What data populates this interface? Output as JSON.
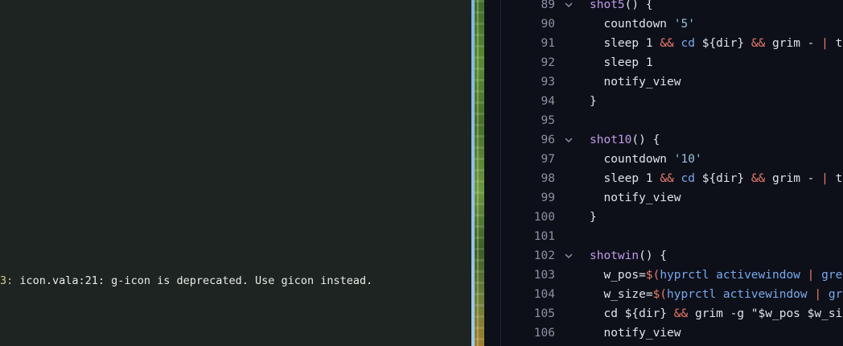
{
  "terminal": {
    "line_prefix": "3:",
    "line_message": " icon.vala:21: g-icon is deprecated. Use gicon instead."
  },
  "editor": {
    "lines": [
      {
        "num": "89",
        "fold": true,
        "tokens": [
          {
            "t": "shot5",
            "c": "fn"
          },
          {
            "t": "() {",
            "c": "pl"
          }
        ]
      },
      {
        "num": "90",
        "fold": false,
        "tokens": [
          {
            "t": "  countdown ",
            "c": "pl"
          },
          {
            "t": "'5'",
            "c": "str"
          }
        ]
      },
      {
        "num": "91",
        "fold": false,
        "tokens": [
          {
            "t": "  sleep 1 ",
            "c": "pl"
          },
          {
            "t": "&&",
            "c": "op"
          },
          {
            "t": " ",
            "c": "pl"
          },
          {
            "t": "cd",
            "c": "kw"
          },
          {
            "t": " ${dir} ",
            "c": "pl"
          },
          {
            "t": "&&",
            "c": "op"
          },
          {
            "t": " grim - ",
            "c": "pl"
          },
          {
            "t": "|",
            "c": "op"
          },
          {
            "t": " te",
            "c": "pl"
          }
        ]
      },
      {
        "num": "92",
        "fold": false,
        "tokens": [
          {
            "t": "  sleep 1",
            "c": "pl"
          }
        ]
      },
      {
        "num": "93",
        "fold": false,
        "tokens": [
          {
            "t": "  notify_view",
            "c": "pl"
          }
        ]
      },
      {
        "num": "94",
        "fold": false,
        "tokens": [
          {
            "t": "}",
            "c": "pl"
          }
        ]
      },
      {
        "num": "95",
        "fold": false,
        "tokens": []
      },
      {
        "num": "96",
        "fold": true,
        "tokens": [
          {
            "t": "shot10",
            "c": "fn"
          },
          {
            "t": "() {",
            "c": "pl"
          }
        ]
      },
      {
        "num": "97",
        "fold": false,
        "tokens": [
          {
            "t": "  countdown ",
            "c": "pl"
          },
          {
            "t": "'10'",
            "c": "str"
          }
        ]
      },
      {
        "num": "98",
        "fold": false,
        "tokens": [
          {
            "t": "  sleep 1 ",
            "c": "pl"
          },
          {
            "t": "&&",
            "c": "op"
          },
          {
            "t": " ",
            "c": "pl"
          },
          {
            "t": "cd",
            "c": "kw"
          },
          {
            "t": " ${dir} ",
            "c": "pl"
          },
          {
            "t": "&&",
            "c": "op"
          },
          {
            "t": " grim - ",
            "c": "pl"
          },
          {
            "t": "|",
            "c": "op"
          },
          {
            "t": " te",
            "c": "pl"
          }
        ]
      },
      {
        "num": "99",
        "fold": false,
        "tokens": [
          {
            "t": "  notify_view",
            "c": "pl"
          }
        ]
      },
      {
        "num": "100",
        "fold": false,
        "tokens": [
          {
            "t": "}",
            "c": "pl"
          }
        ]
      },
      {
        "num": "101",
        "fold": false,
        "tokens": []
      },
      {
        "num": "102",
        "fold": true,
        "tokens": [
          {
            "t": "shotwin",
            "c": "fn"
          },
          {
            "t": "() {",
            "c": "pl"
          }
        ]
      },
      {
        "num": "103",
        "fold": false,
        "tokens": [
          {
            "t": "  w_pos=",
            "c": "pl"
          },
          {
            "t": "$(",
            "c": "op"
          },
          {
            "t": "hyprctl activewindow ",
            "c": "kw"
          },
          {
            "t": "|",
            "c": "op"
          },
          {
            "t": " grep",
            "c": "kw"
          }
        ]
      },
      {
        "num": "104",
        "fold": false,
        "tokens": [
          {
            "t": "  w_size=",
            "c": "pl"
          },
          {
            "t": "$(",
            "c": "op"
          },
          {
            "t": "hyprctl activewindow ",
            "c": "kw"
          },
          {
            "t": "|",
            "c": "op"
          },
          {
            "t": " gre",
            "c": "kw"
          }
        ]
      },
      {
        "num": "105",
        "fold": false,
        "tokens": [
          {
            "t": "  cd ${dir} ",
            "c": "pl"
          },
          {
            "t": "&&",
            "c": "op"
          },
          {
            "t": " grim -g \"$w_pos $w_siz",
            "c": "pl"
          }
        ]
      },
      {
        "num": "106",
        "fold": false,
        "tokens": [
          {
            "t": "  notify_view",
            "c": "pl"
          }
        ]
      }
    ]
  }
}
